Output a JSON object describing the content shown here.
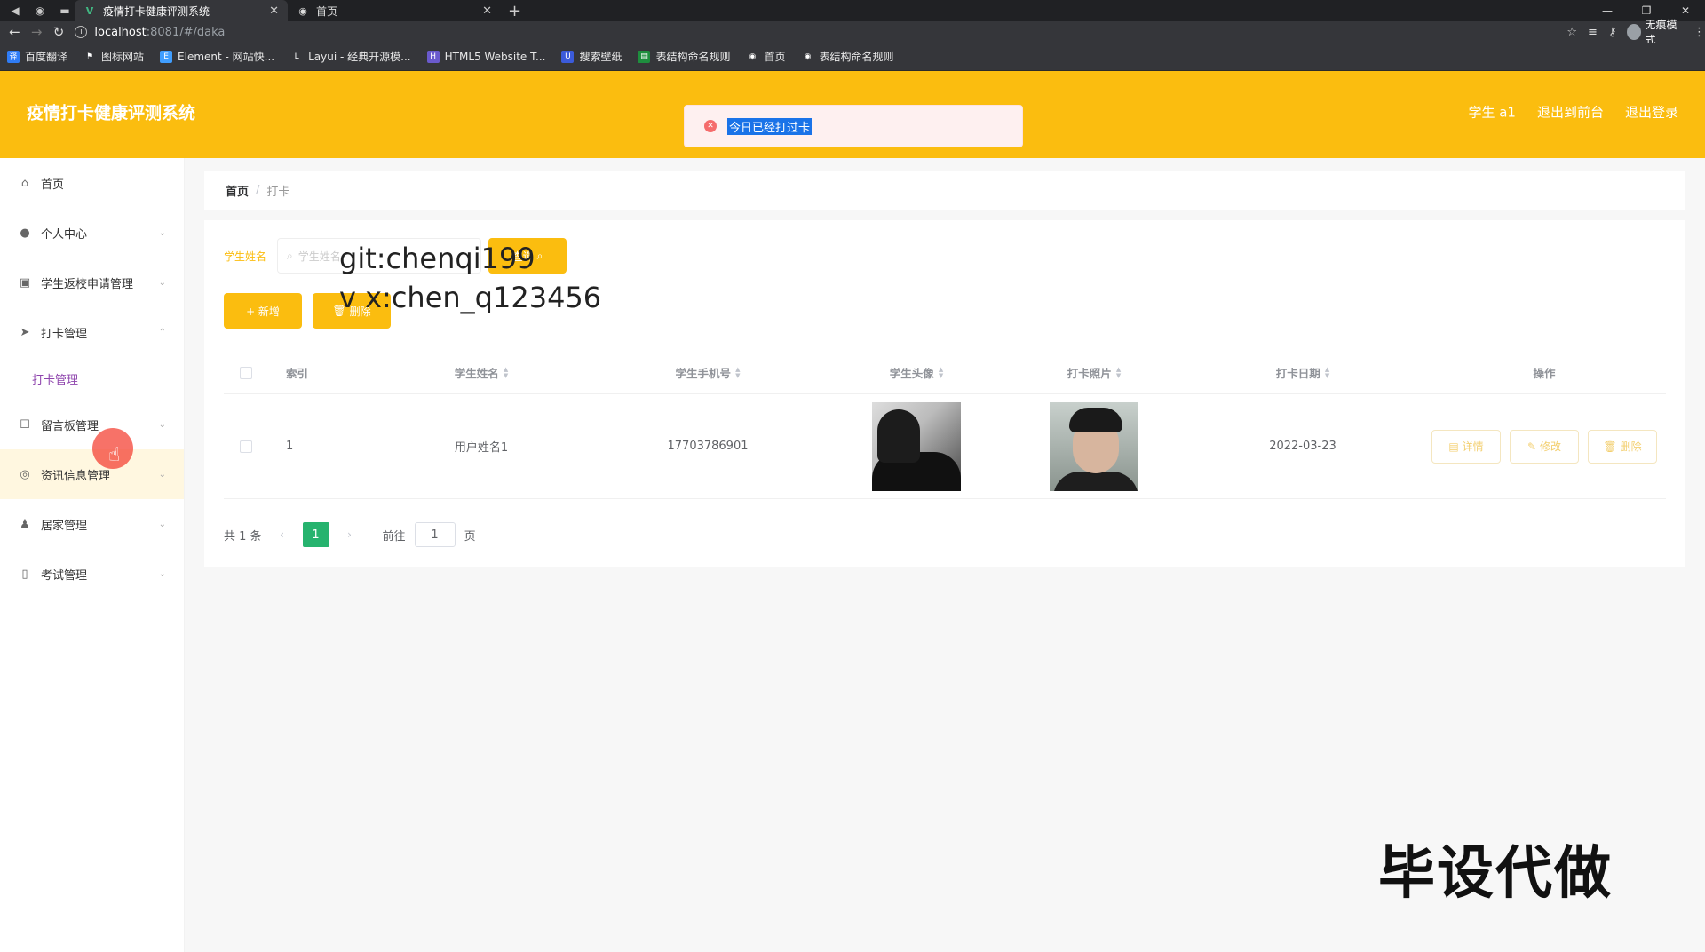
{
  "browser": {
    "tabs": [
      {
        "title": "疫情打卡健康评测系统",
        "active": true
      },
      {
        "title": "首页",
        "active": false
      }
    ],
    "url_host": "localhost",
    "url_path": ":8081/#/daka",
    "incognito_label": "无痕模式",
    "bookmarks": [
      "百度翻译",
      "图标网站",
      "Element - 网站快...",
      "Layui - 经典开源模...",
      "HTML5 Website T...",
      "搜索壁纸",
      "表结构命名规则",
      "首页",
      "表结构命名规则"
    ]
  },
  "header": {
    "app_title": "疫情打卡健康评测系统",
    "user": "学生 a1",
    "back_to_front": "退出到前台",
    "logout": "退出登录",
    "toast_message": "今日已经打过卡"
  },
  "sidebar": {
    "items": [
      {
        "label": "首页",
        "icon": "home-icon"
      },
      {
        "label": "个人中心",
        "icon": "user-icon"
      },
      {
        "label": "学生返校申请管理",
        "icon": "clipboard-icon"
      },
      {
        "label": "打卡管理",
        "icon": "send-icon"
      },
      {
        "label": "留言板管理",
        "icon": "message-icon"
      },
      {
        "label": "资讯信息管理",
        "icon": "compass-icon"
      },
      {
        "label": "居家管理",
        "icon": "person-icon"
      },
      {
        "label": "考试管理",
        "icon": "exam-icon"
      }
    ],
    "submenu_active": "打卡管理"
  },
  "breadcrumb": {
    "home": "首页",
    "current": "打卡"
  },
  "search": {
    "label": "学生姓名",
    "placeholder": "学生姓名",
    "query_button": "查询"
  },
  "overlay": {
    "git": "git:chenqi199",
    "vx": "v x:chen_q123456"
  },
  "toolbar": {
    "add_button": "+ 新增",
    "delete_button": "删除"
  },
  "table": {
    "headers": {
      "index": "索引",
      "name": "学生姓名",
      "phone": "学生手机号",
      "avatar": "学生头像",
      "photo": "打卡照片",
      "date": "打卡日期",
      "ops": "操作"
    },
    "rows": [
      {
        "index": "1",
        "name": "用户姓名1",
        "phone": "17703786901",
        "date": "2022-03-23"
      }
    ],
    "ops": {
      "detail": "详情",
      "edit": "修改",
      "delete": "删除"
    }
  },
  "pager": {
    "total": "共 1 条",
    "current_page": "1",
    "goto_label": "前往",
    "goto_value": "1",
    "page_unit": "页"
  },
  "watermark": "毕设代做",
  "colors": {
    "accent": "#fbbd0f",
    "pager_active": "#26b36e",
    "submenu": "#8e44ad"
  }
}
